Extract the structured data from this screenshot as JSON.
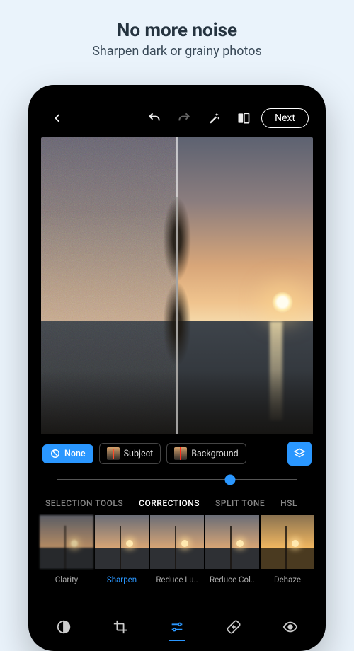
{
  "promo": {
    "title": "No more noise",
    "subtitle": "Sharpen dark or grainy photos"
  },
  "topbar": {
    "next_label": "Next"
  },
  "masks": {
    "none_label": "None",
    "subject_label": "Subject",
    "background_label": "Background"
  },
  "slider": {
    "value_percent": 72
  },
  "tabs": {
    "items": [
      "SELECTION TOOLS",
      "CORRECTIONS",
      "SPLIT TONE",
      "HSL"
    ],
    "active_index": 1
  },
  "presets": {
    "items": [
      {
        "label": "Clarity"
      },
      {
        "label": "Sharpen"
      },
      {
        "label": "Reduce Lu.."
      },
      {
        "label": "Reduce Col.."
      },
      {
        "label": "Dehaze"
      }
    ],
    "active_index": 1
  },
  "bottombar": {
    "icons": [
      "contrast",
      "crop",
      "sliders",
      "heal",
      "eye"
    ],
    "active_index": 2
  },
  "colors": {
    "accent": "#2a97ff"
  }
}
